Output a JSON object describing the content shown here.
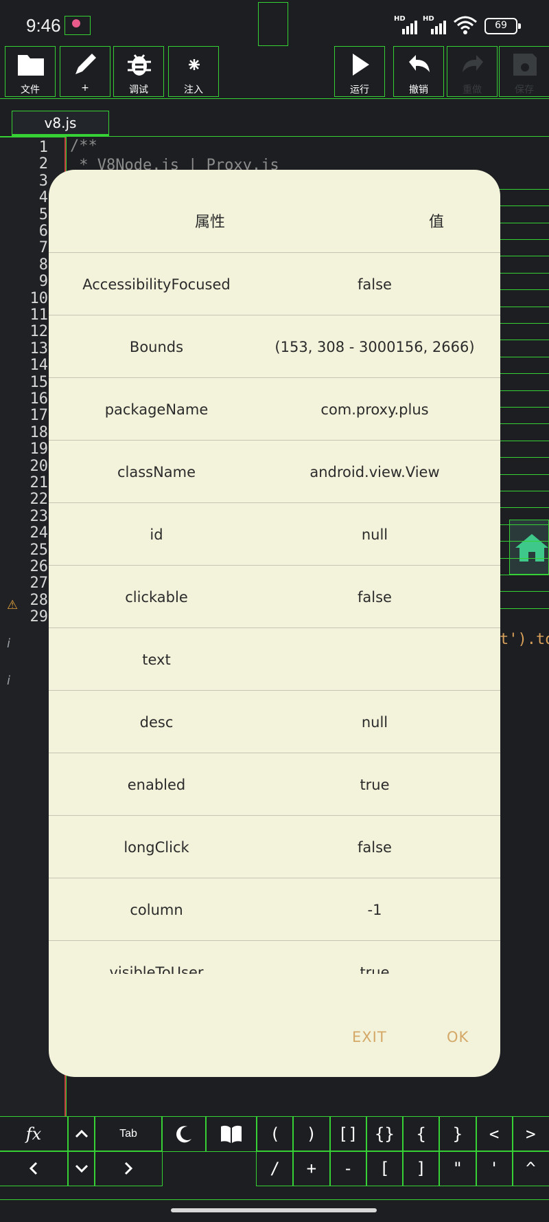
{
  "status": {
    "time": "9:46",
    "battery": "69",
    "signal_label": "HD"
  },
  "toolbar": {
    "file": "文件",
    "edit": "+",
    "debug": "调试",
    "inject": "注入",
    "run": "运行",
    "undo": "撤销",
    "redo": "重做",
    "save": "保存"
  },
  "tab": {
    "name": "v8.js"
  },
  "editor": {
    "line_numbers": [
      "1",
      "2",
      "3",
      "4",
      "5",
      "6",
      "7",
      "8",
      "9",
      "10",
      "11",
      "12",
      "13",
      "14",
      "15",
      "16",
      "17",
      "18",
      "19",
      "20",
      "21",
      "22",
      "23",
      "24",
      "25",
      "26",
      "27",
      "28",
      "29"
    ],
    "line1": "/**",
    "line2": " * V8Node.js | Proxy.js",
    "line27_tail": "t').to"
  },
  "dialog": {
    "header_key": "属性",
    "header_value": "值",
    "rows": [
      {
        "key": "AccessibilityFocused",
        "value": "false"
      },
      {
        "key": "Bounds",
        "value": "(153, 308 - 3000156, 2666)"
      },
      {
        "key": "packageName",
        "value": "com.proxy.plus"
      },
      {
        "key": "className",
        "value": "android.view.View"
      },
      {
        "key": "id",
        "value": "null"
      },
      {
        "key": "clickable",
        "value": "false"
      },
      {
        "key": "text",
        "value": ""
      },
      {
        "key": "desc",
        "value": "null"
      },
      {
        "key": "enabled",
        "value": "true"
      },
      {
        "key": "longClick",
        "value": "false"
      },
      {
        "key": "column",
        "value": "-1"
      },
      {
        "key": "visibleToUser",
        "value": "true"
      }
    ],
    "exit": "EXIT",
    "ok": "OK"
  },
  "keys": {
    "fx": "fx",
    "tab": "Tab",
    "row1": [
      "(",
      ")",
      "[]",
      "{}",
      "{",
      "}",
      "<",
      ">"
    ],
    "row2": [
      "/",
      "+",
      "-",
      "[",
      "]",
      "\"",
      "'",
      "^"
    ]
  }
}
